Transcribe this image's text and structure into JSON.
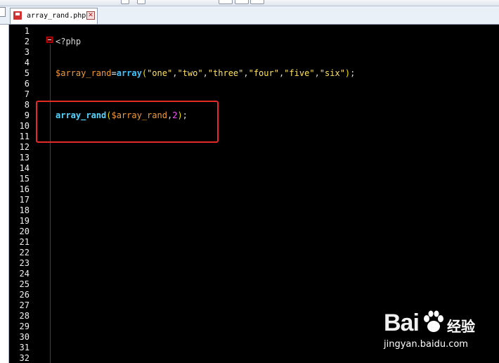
{
  "tab": {
    "filename": "array_rand.php",
    "close_glyph": "✕"
  },
  "editor": {
    "line_numbers": [
      "1",
      "2",
      "3",
      "4",
      "5",
      "6",
      "7",
      "8",
      "9",
      "10",
      "11",
      "12",
      "13",
      "14",
      "15",
      "16",
      "17",
      "18",
      "19",
      "20",
      "21",
      "22",
      "23",
      "24",
      "25",
      "26",
      "27",
      "28",
      "29",
      "30",
      "31",
      "32"
    ],
    "code": {
      "line2": {
        "php_open": "<?php"
      },
      "line5": {
        "var": "$array_rand",
        "eq": "=",
        "keyword": "array",
        "open": "(",
        "s1": "\"one\"",
        "c1": ",",
        "s2": "\"two\"",
        "c2": ",",
        "s3": "\"three\"",
        "c3": ",",
        "s4": "\"four\"",
        "c4": ",",
        "s5": "\"five\"",
        "c5": ",",
        "s6": "\"six\"",
        "close": ")",
        "semi": ";"
      },
      "line9": {
        "func": "array_rand",
        "open": "(",
        "arg": "$array_rand",
        "comma": ",",
        "num": "2",
        "close": ")",
        "semi": ";"
      }
    }
  },
  "watermark": {
    "logo": "Bai",
    "logo_suffix": "经验",
    "domain": "jingyan.baidu.com"
  },
  "colors": {
    "editor_bg": "#000000",
    "fold_line": "#d20000",
    "highlight_border": "#e52929",
    "string": "#ffe35a",
    "variable": "#f59b2f",
    "keyword": "#40c2ff",
    "number": "#ff50ff"
  }
}
